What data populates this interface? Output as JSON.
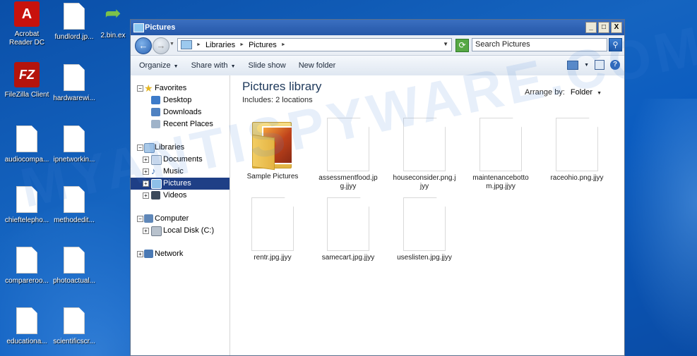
{
  "desktop": {
    "icons": [
      {
        "label": "Acrobat Reader DC",
        "icon": "acrobat-icon"
      },
      {
        "label": "fundlord.jp...",
        "icon": "document-icon"
      },
      {
        "label": "2.bin.ex",
        "icon": "arrow-shortcut-icon"
      },
      {
        "label": "FileZilla Client",
        "icon": "filezilla-icon"
      },
      {
        "label": "hardwarewi...",
        "icon": "document-icon"
      },
      {
        "label": "audiocompa...",
        "icon": "document-icon"
      },
      {
        "label": "ipnetworkin...",
        "icon": "document-icon"
      },
      {
        "label": "chieftelepho...",
        "icon": "document-icon"
      },
      {
        "label": "methodedit...",
        "icon": "document-icon"
      },
      {
        "label": "compareroo...",
        "icon": "document-icon"
      },
      {
        "label": "photoactual...",
        "icon": "document-icon"
      },
      {
        "label": "educationa...",
        "icon": "document-icon"
      },
      {
        "label": "scientificscr...",
        "icon": "document-icon"
      }
    ]
  },
  "window": {
    "title": "Pictures",
    "controls": {
      "minimize": "_",
      "maximize": "□",
      "close": "X"
    }
  },
  "address": {
    "crumbs": [
      "Libraries",
      "Pictures"
    ],
    "search_placeholder": "Search Pictures"
  },
  "toolbar": {
    "organize": "Organize",
    "share": "Share with",
    "slideshow": "Slide show",
    "newfolder": "New folder"
  },
  "nav": {
    "favorites": {
      "label": "Favorites",
      "items": [
        "Desktop",
        "Downloads",
        "Recent Places"
      ]
    },
    "libraries": {
      "label": "Libraries",
      "items": [
        "Documents",
        "Music",
        "Pictures",
        "Videos"
      ]
    },
    "computer": {
      "label": "Computer",
      "items": [
        "Local Disk (C:)"
      ]
    },
    "network": {
      "label": "Network"
    }
  },
  "library": {
    "title": "Pictures library",
    "includes": "Includes:  2 locations",
    "arrange_label": "Arrange by:",
    "arrange_value": "Folder"
  },
  "files": [
    {
      "name": "Sample Pictures",
      "type": "folder"
    },
    {
      "name": "assessmentfood.jpg.jjyy",
      "type": "file"
    },
    {
      "name": "houseconsider.png.jjyy",
      "type": "file"
    },
    {
      "name": "maintenancebottom.jpg.jjyy",
      "type": "file"
    },
    {
      "name": "raceohio.png.jjyy",
      "type": "file"
    },
    {
      "name": "rentr.jpg.jjyy",
      "type": "file"
    },
    {
      "name": "samecart.jpg.jjyy",
      "type": "file"
    },
    {
      "name": "useslisten.jpg.jjyy",
      "type": "file"
    }
  ],
  "watermark": "MYANTISPYWARE.COM"
}
